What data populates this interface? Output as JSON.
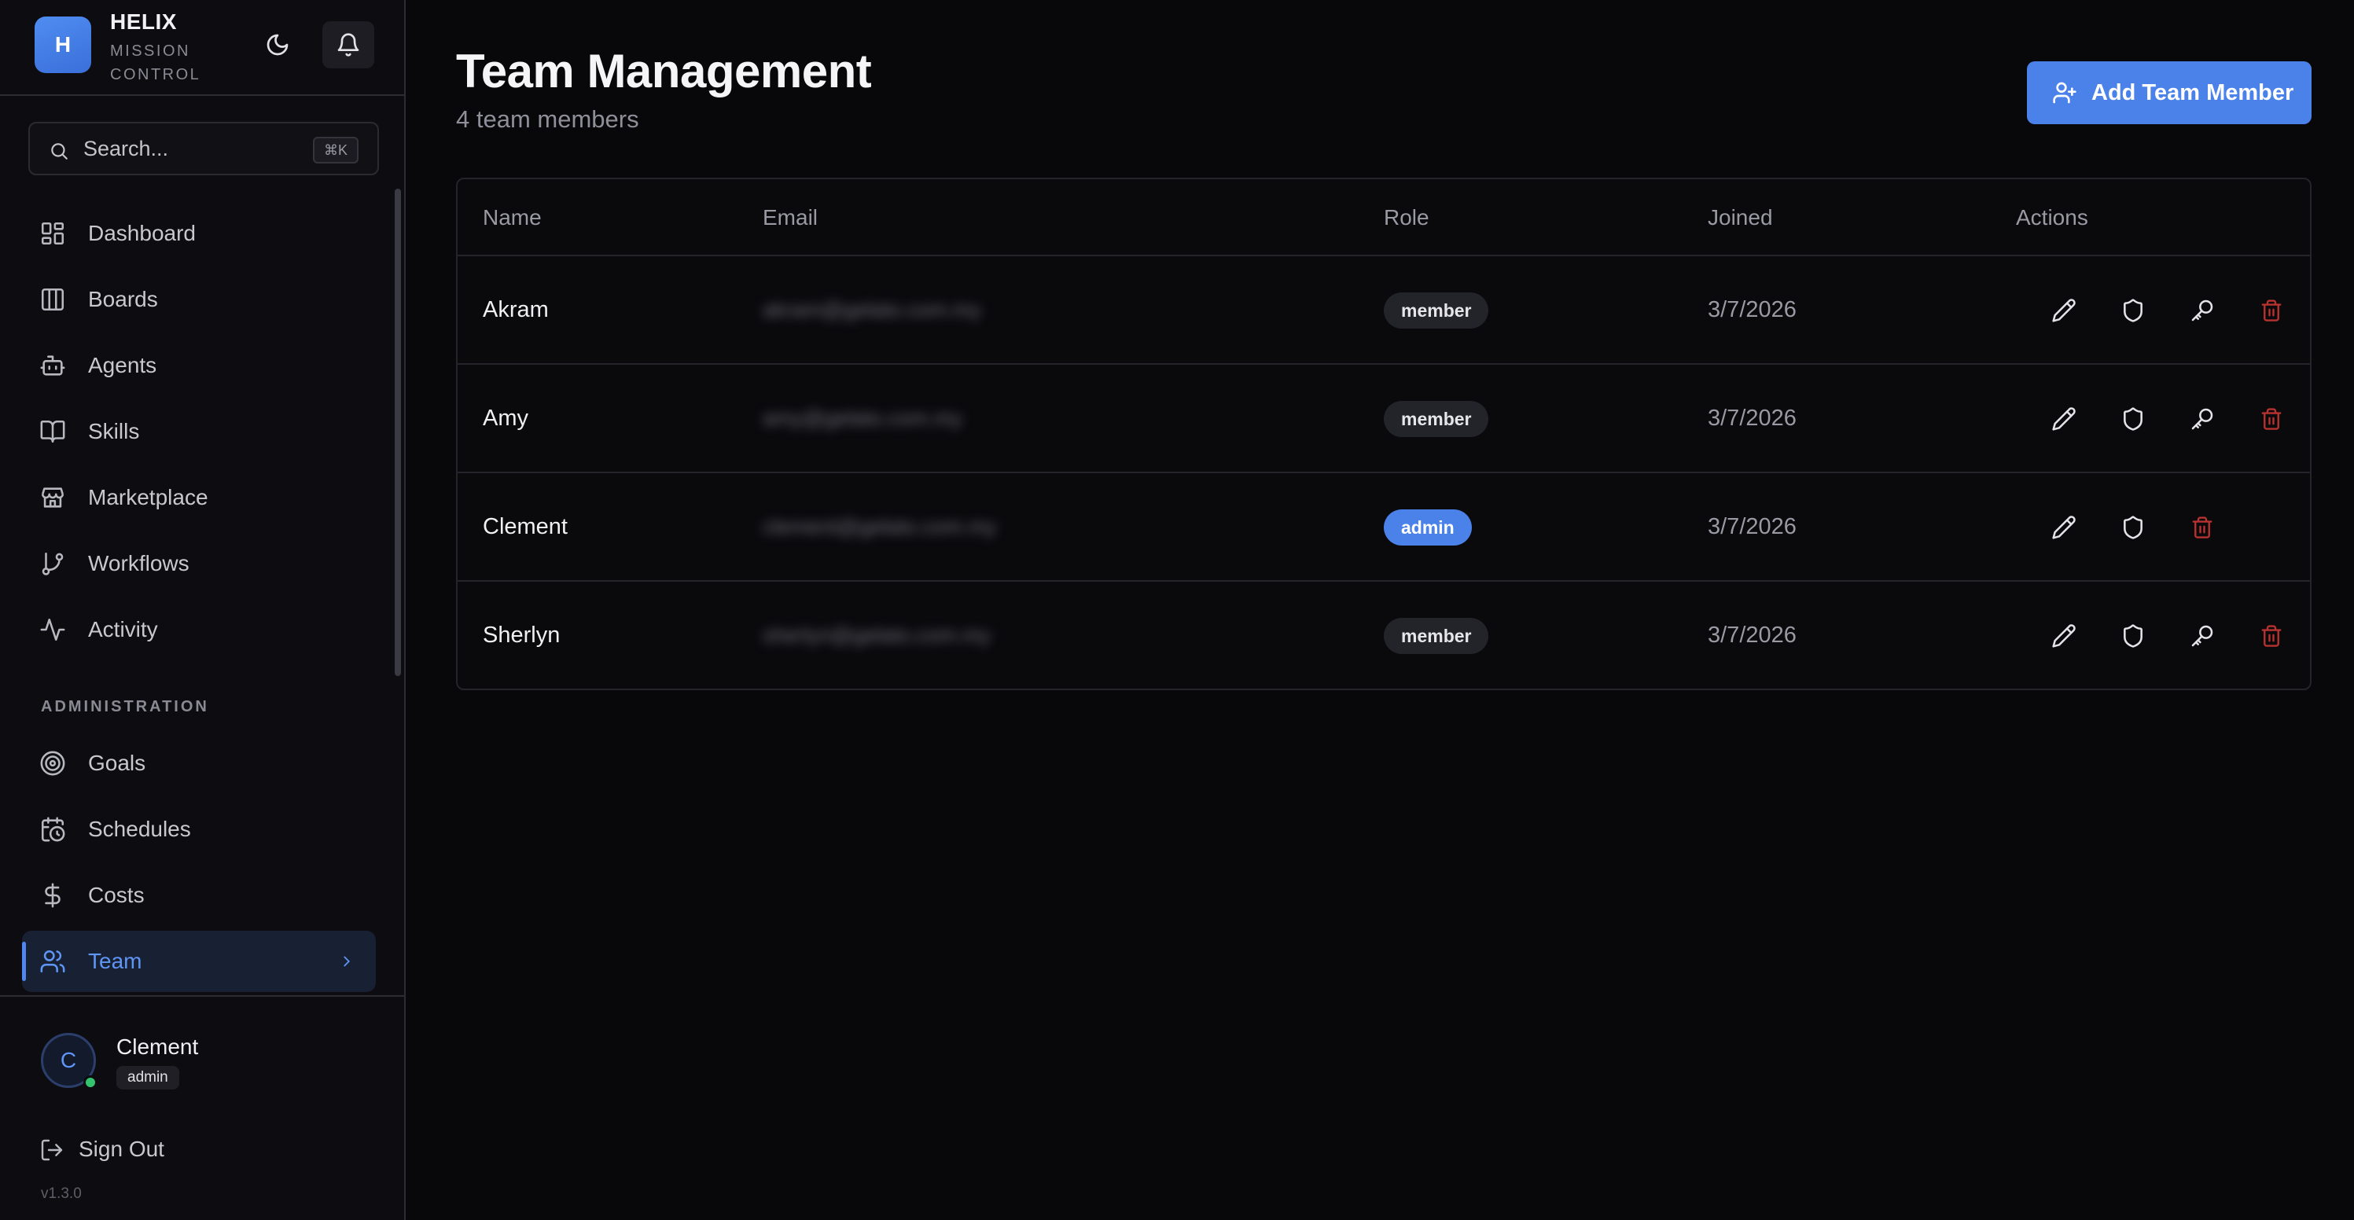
{
  "app": {
    "logo_letter": "H",
    "name": "HELIX",
    "subtitle": "MISSION CONTROL",
    "version": "v1.3.0"
  },
  "search": {
    "placeholder": "Search...",
    "shortcut": "⌘K"
  },
  "nav": {
    "items": [
      {
        "label": "Dashboard",
        "icon": "dashboard-icon"
      },
      {
        "label": "Boards",
        "icon": "columns-icon"
      },
      {
        "label": "Agents",
        "icon": "bot-icon"
      },
      {
        "label": "Skills",
        "icon": "book-icon"
      },
      {
        "label": "Marketplace",
        "icon": "store-icon"
      },
      {
        "label": "Workflows",
        "icon": "git-branch-icon"
      },
      {
        "label": "Activity",
        "icon": "activity-icon"
      }
    ],
    "admin_section_label": "ADMINISTRATION",
    "admin_items": [
      {
        "label": "Goals",
        "icon": "target-icon"
      },
      {
        "label": "Schedules",
        "icon": "calendar-clock-icon"
      },
      {
        "label": "Costs",
        "icon": "dollar-icon"
      },
      {
        "label": "Team",
        "icon": "users-icon",
        "active": true
      }
    ]
  },
  "user": {
    "initial": "C",
    "name": "Clement",
    "role": "admin",
    "sign_out_label": "Sign Out"
  },
  "page": {
    "title": "Team Management",
    "subtitle": "4 team members",
    "add_button_label": "Add Team Member"
  },
  "table": {
    "columns": [
      "Name",
      "Email",
      "Role",
      "Joined",
      "Actions"
    ],
    "rows": [
      {
        "name": "Akram",
        "email": "akram@gelato.com.my",
        "role": "member",
        "joined": "3/7/2026",
        "actions": [
          "edit",
          "permissions",
          "reset-password",
          "delete"
        ]
      },
      {
        "name": "Amy",
        "email": "amy@gelato.com.my",
        "role": "member",
        "joined": "3/7/2026",
        "actions": [
          "edit",
          "permissions",
          "reset-password",
          "delete"
        ]
      },
      {
        "name": "Clement",
        "email": "clement@gelato.com.my",
        "role": "admin",
        "joined": "3/7/2026",
        "actions": [
          "edit",
          "permissions",
          "delete"
        ]
      },
      {
        "name": "Sherlyn",
        "email": "sherlyn@gelato.com.my",
        "role": "member",
        "joined": "3/7/2026",
        "actions": [
          "edit",
          "permissions",
          "reset-password",
          "delete"
        ]
      }
    ]
  },
  "colors": {
    "accent": "#4b82ea",
    "danger": "#b8322f",
    "background": "#08080b",
    "sidebar": "#0d0d11"
  }
}
